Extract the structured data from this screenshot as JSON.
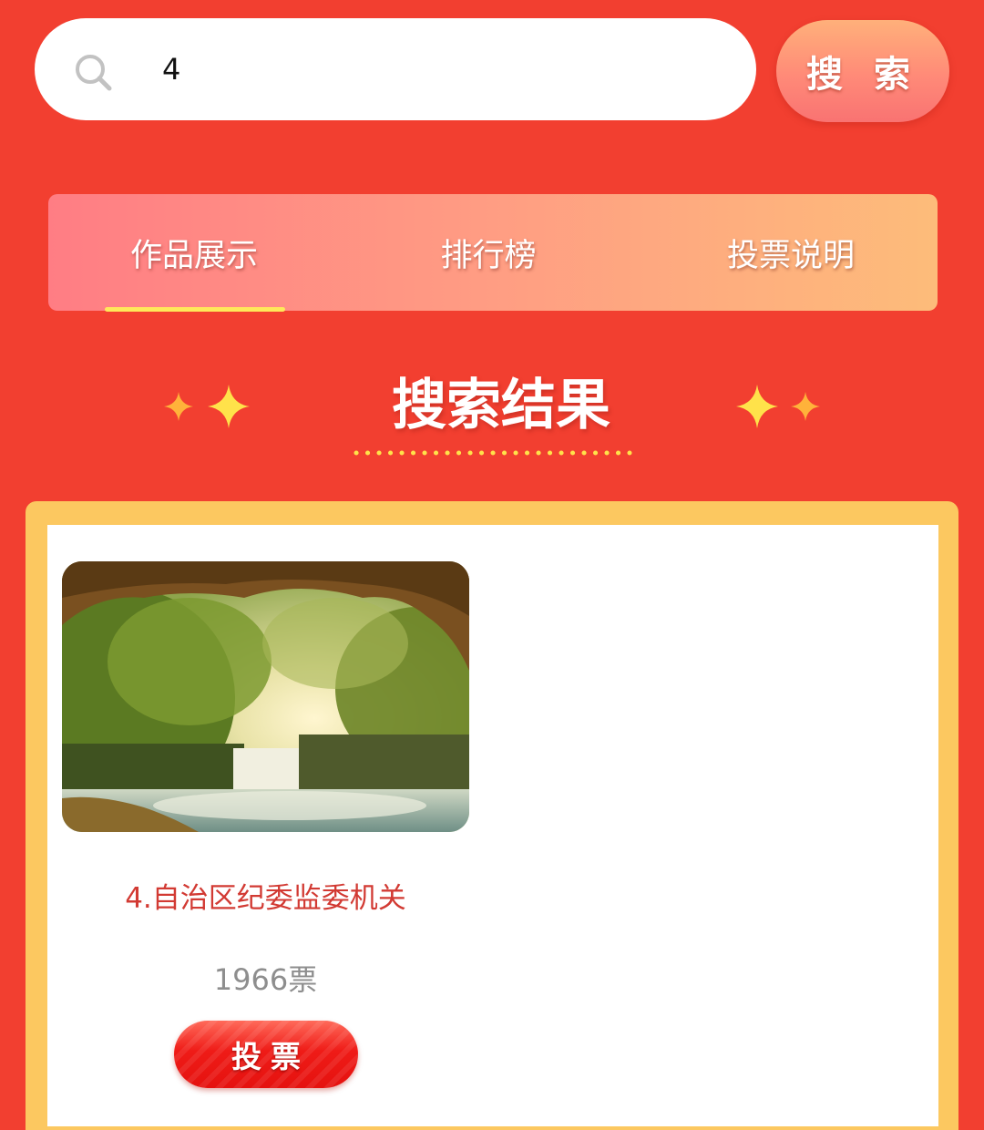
{
  "search": {
    "value": "4",
    "button_label": "搜 索"
  },
  "tabs": [
    {
      "label": "作品展示",
      "active": true
    },
    {
      "label": "排行榜",
      "active": false
    },
    {
      "label": "投票说明",
      "active": false
    }
  ],
  "section": {
    "title": "搜索结果"
  },
  "results": [
    {
      "title": "4.自治区纪委监委机关",
      "votes": "1966票",
      "vote_button": "投票"
    }
  ],
  "colors": {
    "background": "#f23f30",
    "panel_border": "#fcc860",
    "accent_red": "#d23a33",
    "tab_underline": "#ffe85a",
    "sparkle": "#ffe24a"
  },
  "icons": {
    "search": "magnifier",
    "sparkles": "four-point-star"
  }
}
